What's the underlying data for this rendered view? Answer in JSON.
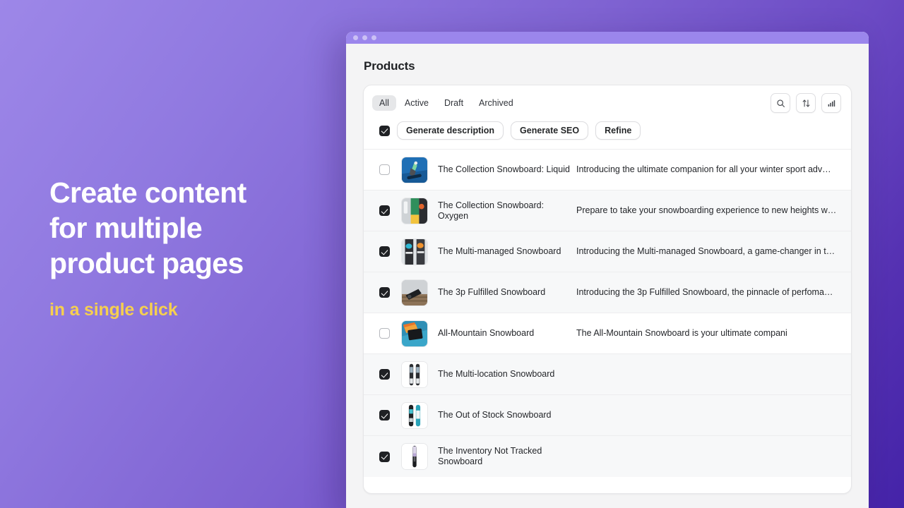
{
  "promo": {
    "heading_lines": [
      "Create content",
      "for multiple",
      "product pages"
    ],
    "subheading": "in a single click",
    "heading_color": "#ffffff",
    "subheading_color": "#f6cf4f",
    "background_from": "#9d87e8",
    "background_to": "#4423a8"
  },
  "window": {
    "titlebar_color": "#9b86ec",
    "traffic_light_count": 3
  },
  "app": {
    "page_title": "Products"
  },
  "tabs": [
    {
      "label": "All",
      "active": true
    },
    {
      "label": "Active",
      "active": false
    },
    {
      "label": "Draft",
      "active": false
    },
    {
      "label": "Archived",
      "active": false
    }
  ],
  "icon_buttons": [
    {
      "name": "search-icon",
      "label": "Search"
    },
    {
      "name": "sort-icon",
      "label": "Sort"
    },
    {
      "name": "bar-chart-icon",
      "label": "Analytics"
    }
  ],
  "action_bar": {
    "select_all_checked": true,
    "buttons": [
      {
        "label": "Generate description"
      },
      {
        "label": "Generate SEO"
      },
      {
        "label": "Refine"
      }
    ]
  },
  "products": [
    {
      "checked": false,
      "name": "The Collection Snowboard: Liquid",
      "description": "Introducing the ultimate companion for all your winter sport adv…",
      "thumb": "snowboarder-blue"
    },
    {
      "checked": true,
      "name": "The Collection Snowboard: Oxygen",
      "description": "Prepare to take your snowboarding experience to new heights w…",
      "thumb": "gear-collage"
    },
    {
      "checked": true,
      "name": "The Multi-managed Snowboard",
      "description": "Introducing the Multi-managed Snowboard, a game-changer in t…",
      "thumb": "boots-pair"
    },
    {
      "checked": true,
      "name": "The 3p Fulfilled Snowboard",
      "description": "Introducing the 3p Fulfilled Snowboard, the pinnacle of perfoma…",
      "thumb": "board-on-deck"
    },
    {
      "checked": false,
      "name": "All-Mountain Snowboard",
      "description": "The All-Mountain Snowboard is your ultimate compani",
      "thumb": "board-orange-blue"
    },
    {
      "checked": true,
      "name": "The Multi-location Snowboard",
      "description": "",
      "thumb": "twin-boards"
    },
    {
      "checked": true,
      "name": "The Out of Stock Snowboard",
      "description": "",
      "thumb": "teal-boards"
    },
    {
      "checked": true,
      "name": "The Inventory Not Tracked Snowboard",
      "description": "",
      "thumb": "single-board"
    }
  ]
}
